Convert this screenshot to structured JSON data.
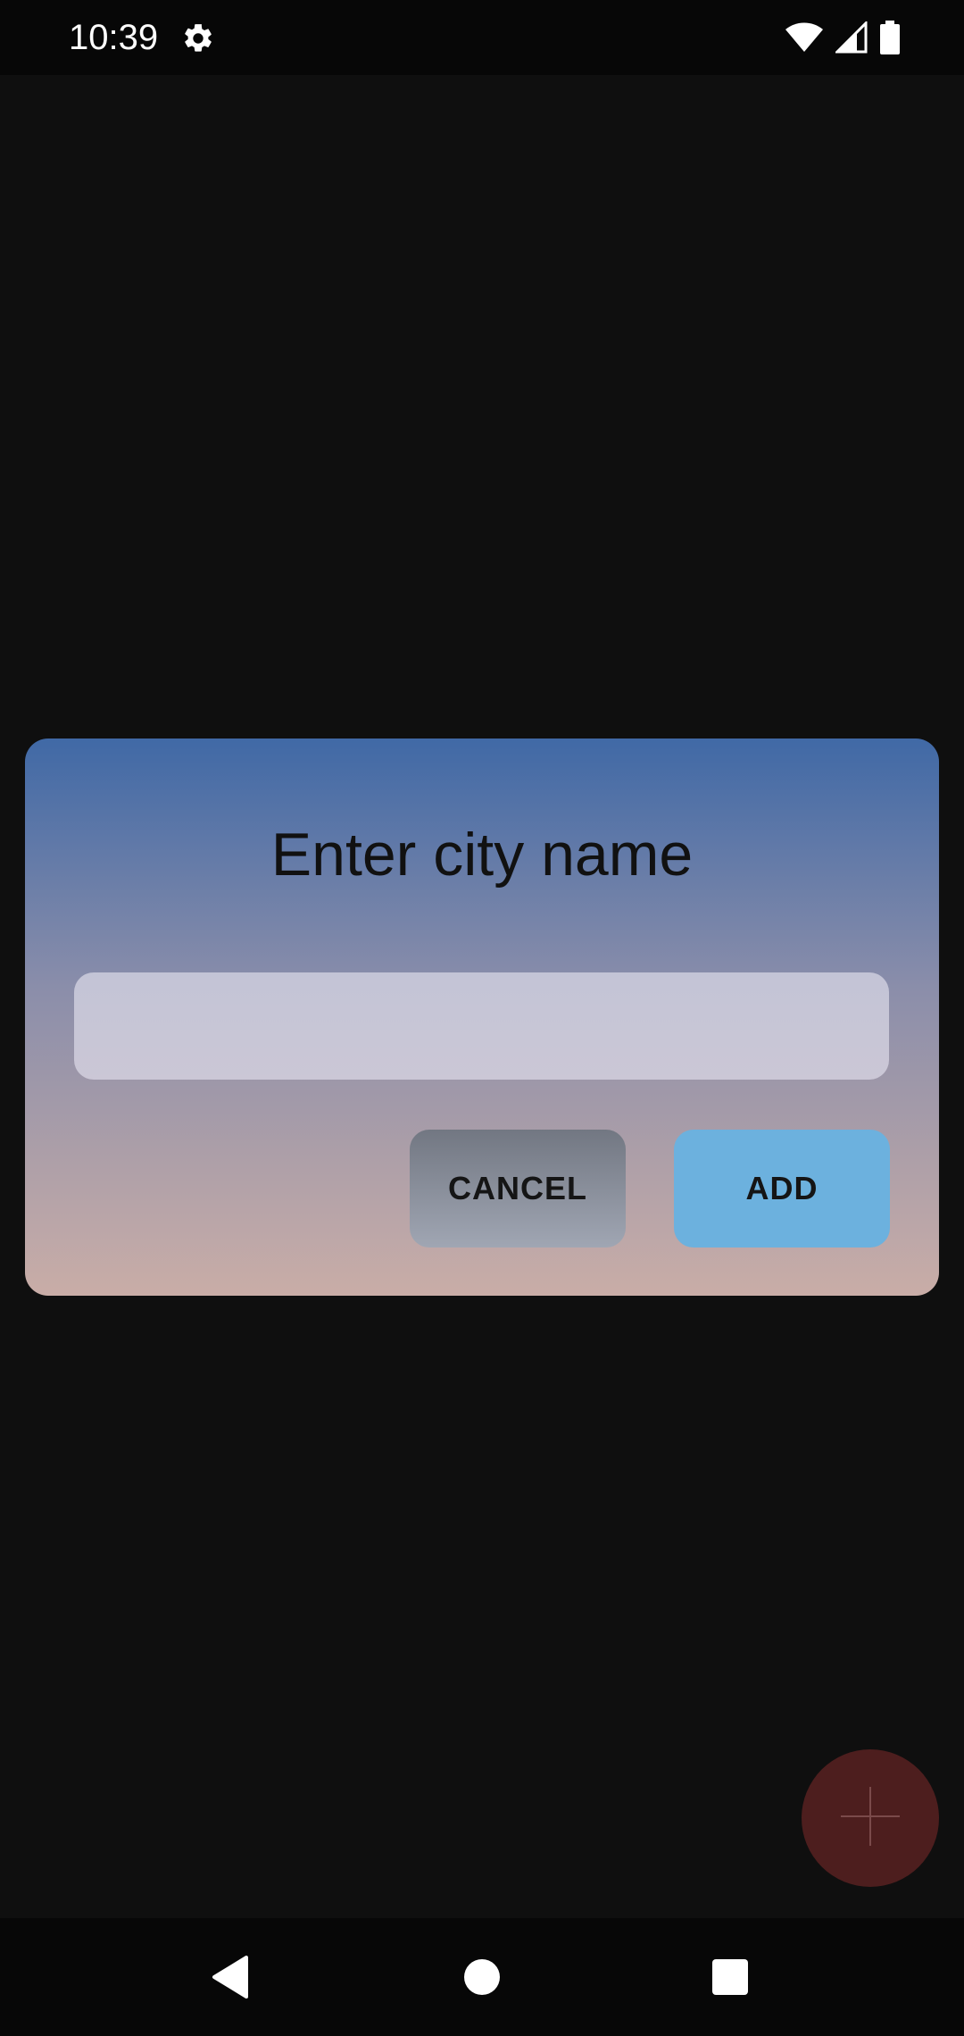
{
  "status_bar": {
    "time": "10:39",
    "icons": [
      "gear-icon",
      "wifi-icon",
      "signal-icon",
      "battery-icon"
    ]
  },
  "dialog": {
    "title": "Enter city name",
    "input_value": "",
    "input_placeholder": "",
    "cancel_label": "CANCEL",
    "add_label": "ADD"
  },
  "fab": {
    "icon": "plus-icon"
  },
  "nav_bar": {
    "icons": [
      "back-icon",
      "home-icon",
      "recents-icon"
    ]
  },
  "colors": {
    "background": "#0f0f0f",
    "dialog_gradient_top": "#4069a6",
    "dialog_gradient_bottom": "#c9ada7",
    "add_button": "#6cb1de",
    "cancel_button": "#8a8f9b",
    "fab": "#4d1e1e"
  }
}
